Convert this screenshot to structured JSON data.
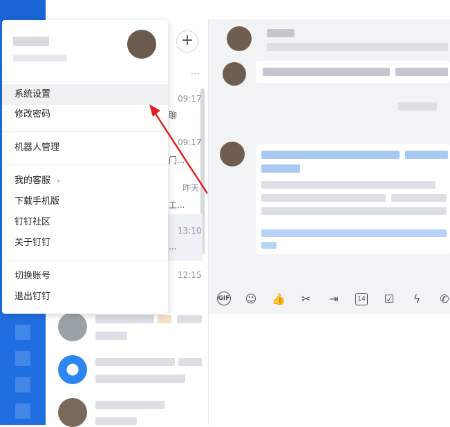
{
  "menu": {
    "items": [
      {
        "label": "系统设置"
      },
      {
        "label": "修改密码"
      },
      {
        "label": "机器人管理"
      },
      {
        "label": "我的客服"
      },
      {
        "label": "下载手机版"
      },
      {
        "label": "钉钉社区"
      },
      {
        "label": "关于钉钉"
      },
      {
        "label": "切换账号"
      },
      {
        "label": "退出钉钉"
      }
    ],
    "submenu_caret": "›"
  },
  "conversations": [
    {
      "time": "09:17",
      "snippet": "聊"
    },
    {
      "time": "09:17",
      "snippet": "门..."
    },
    {
      "time": "昨天",
      "snippet": "工..."
    },
    {
      "time": "13:10",
      "snippet": "..."
    },
    {
      "time": "12:15",
      "snippet": ""
    }
  ],
  "list_header": {
    "add_button": "+",
    "more": "···"
  },
  "toolbar": {
    "gif": "GIF",
    "calendar": "14"
  },
  "colors": {
    "rail": "#1f6fe0",
    "arrow": "#e02020",
    "menu_active": "#f0f1f3",
    "chat_bg": "#f2f3f5"
  },
  "icons": [
    "gif-icon",
    "emoji-icon",
    "thumbs-up-icon",
    "scissors-icon",
    "forward-icon",
    "calendar-icon",
    "checkbox-icon",
    "lightning-icon",
    "phone-icon"
  ]
}
